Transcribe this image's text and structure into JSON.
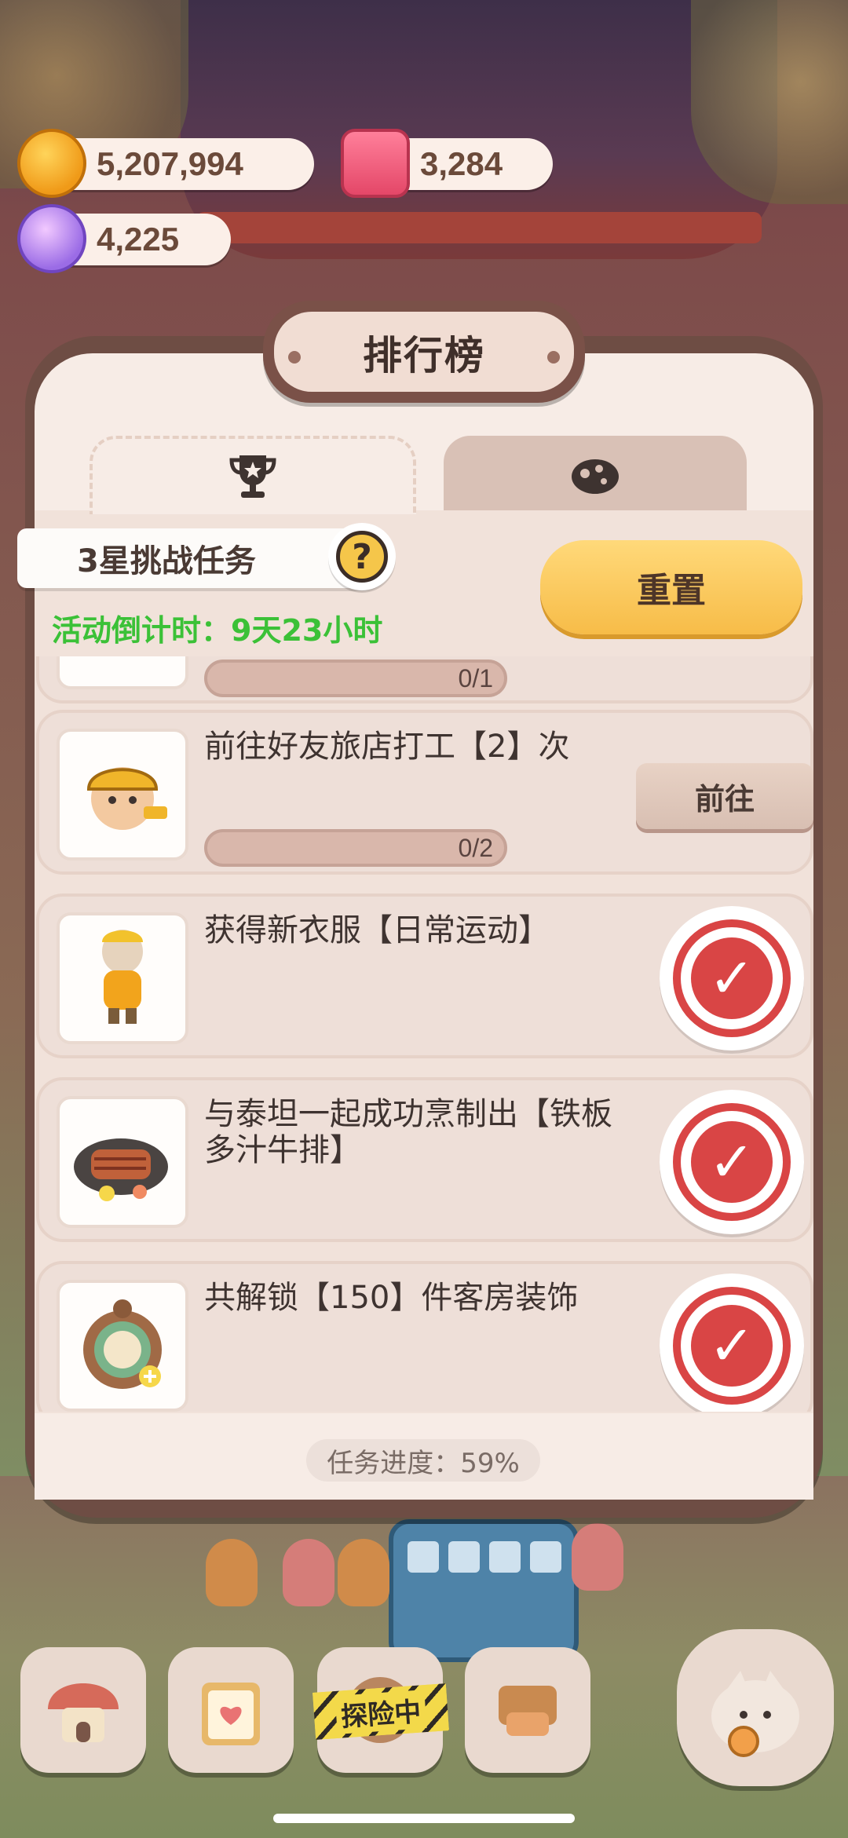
{
  "currencies": [
    {
      "icon": "cookie-coin-icon",
      "value": "5,207,994"
    },
    {
      "icon": "candle-icon",
      "value": "3,284"
    },
    {
      "icon": "crystal-gem-icon",
      "value": "4,225"
    }
  ],
  "panel": {
    "title": "排行榜",
    "tabs": [
      {
        "icon": "trophy-icon",
        "active": true
      },
      {
        "icon": "planet-icon",
        "active": false
      }
    ],
    "challenge_title": "3星挑战任务",
    "help_symbol": "?",
    "countdown": "活动倒计时：9天23小时",
    "reset_label": "重置",
    "partial_progress": "0/1",
    "tasks": [
      {
        "title": "前往好友旅店打工【2】次",
        "progress": "0/2",
        "progress_fraction": 0,
        "action": "前往",
        "done": false,
        "thumb_icon": "worker-character-icon"
      },
      {
        "title": "获得新衣服【日常运动】",
        "done": true,
        "thumb_icon": "outfit-icon"
      },
      {
        "title": "与泰坦一起成功烹制出【铁板多汁牛排】",
        "done": true,
        "thumb_icon": "steak-icon"
      },
      {
        "title": "共解锁【150】件客房装饰",
        "done": true,
        "thumb_icon": "decoration-icon"
      }
    ],
    "footer_progress": "任务进度：59%"
  },
  "bottom_nav": {
    "explore_label": "探险中"
  }
}
